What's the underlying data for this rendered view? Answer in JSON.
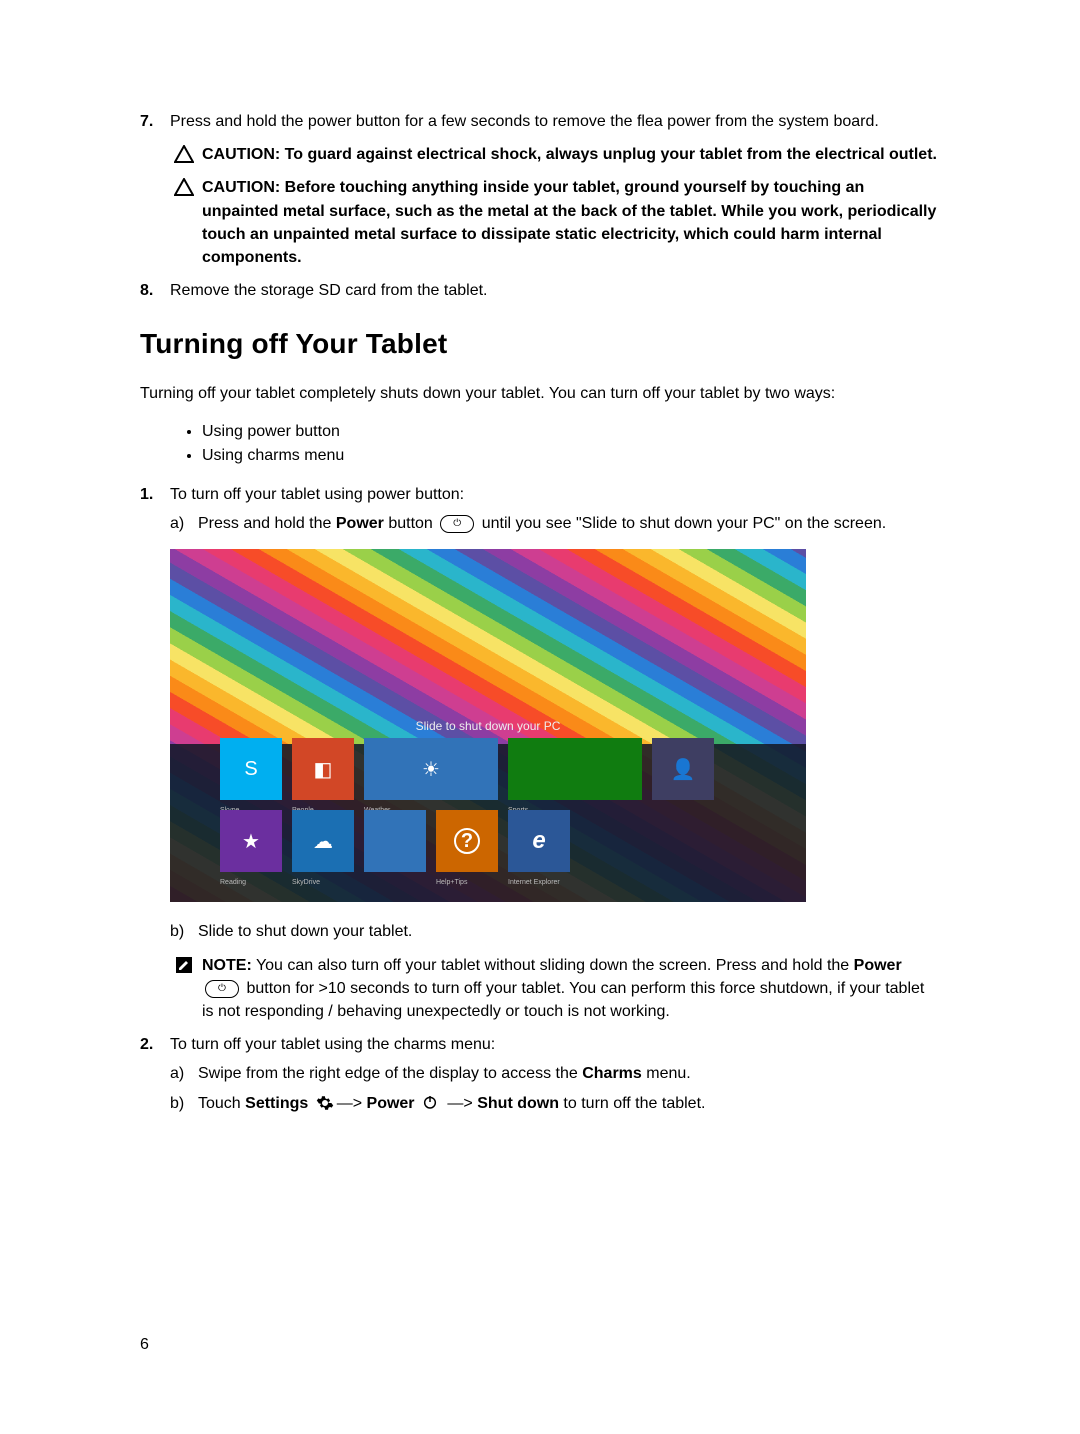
{
  "page_number": "6",
  "step7": {
    "num": "7.",
    "text": "Press and hold the power button for a few seconds to remove the flea power from the system board."
  },
  "caution1": {
    "label": "CAUTION:",
    "text": " To guard against electrical shock, always unplug your tablet from the electrical outlet."
  },
  "caution2": {
    "label": "CAUTION:",
    "text": " Before touching anything inside your tablet, ground yourself by touching an unpainted metal surface, such as the metal at the back of the tablet. While you work, periodically touch an unpainted metal surface to dissipate static electricity, which could harm internal components."
  },
  "step8": {
    "num": "8.",
    "text": "Remove the storage SD card from the tablet."
  },
  "heading": "Turning off Your Tablet",
  "intro": "Turning off your tablet completely shuts down your tablet. You can turn off your tablet by two ways:",
  "bullets": {
    "a": "Using power button",
    "b": "Using charms menu"
  },
  "ol1": {
    "num": "1.",
    "text": "To turn off your tablet using power button:",
    "a": {
      "mark": "a)",
      "pre": "Press and hold the ",
      "power": "Power",
      "post": " button ",
      "tail": " until you see \"Slide to shut down your PC\" on the screen."
    },
    "b": {
      "mark": "b)",
      "text": "Slide to shut down your tablet."
    }
  },
  "figure": {
    "slide_text": "Slide to shut down your PC",
    "tiles": {
      "skype": "Skype",
      "people": "People",
      "weather": "Weather",
      "sports": "Sports",
      "reading": "Reading",
      "skydrive": "SkyDrive",
      "help": "Help+Tips",
      "ie": "Internet Explorer"
    }
  },
  "note": {
    "label": "NOTE:",
    "pre": " You can also turn off your tablet without sliding down the screen. Press and hold the ",
    "power": "Power",
    "post": " ",
    "tail": " button for >10 seconds to turn off your tablet. You can perform this force shutdown, if your tablet is not responding / behaving unexpectedly or touch is not working."
  },
  "ol2": {
    "num": "2.",
    "text": "To turn off your tablet using the charms menu:",
    "a": {
      "mark": "a)",
      "pre": "Swipe from the right edge of the display to access the ",
      "charms": "Charms",
      "post": " menu."
    },
    "b": {
      "mark": "b)",
      "touch": "Touch ",
      "settings": "Settings",
      "arrow1": "—> ",
      "power": "Power",
      "arrow2": " —> ",
      "shutdown": "Shut down",
      "tail": " to turn off the tablet."
    }
  }
}
